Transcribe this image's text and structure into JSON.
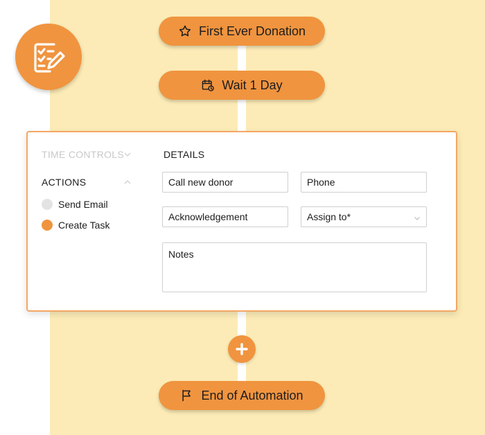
{
  "flow": {
    "trigger": {
      "label": "First Ever Donation",
      "icon": "star-icon"
    },
    "wait": {
      "label": "Wait 1 Day",
      "icon": "calendar-clock-icon"
    },
    "end": {
      "label": "End of Automation",
      "icon": "flag-icon"
    }
  },
  "badge": {
    "icon": "task-checklist-icon"
  },
  "card": {
    "time_controls": "TIME CONTROLS",
    "actions": "ACTIONS",
    "action_items": [
      {
        "label": "Send Email",
        "selected": false
      },
      {
        "label": "Create Task",
        "selected": true
      }
    ],
    "details_title": "DETAILS",
    "fields": {
      "task_name": "Call new donor",
      "task_type": "Phone",
      "category": "Acknowledgement",
      "assign_to": "Assign to*",
      "notes": "Notes"
    }
  },
  "add_step": {
    "icon": "plus-icon"
  },
  "colors": {
    "accent": "#f0943f",
    "background": "#fcebb6",
    "card_border": "#f4a764"
  }
}
